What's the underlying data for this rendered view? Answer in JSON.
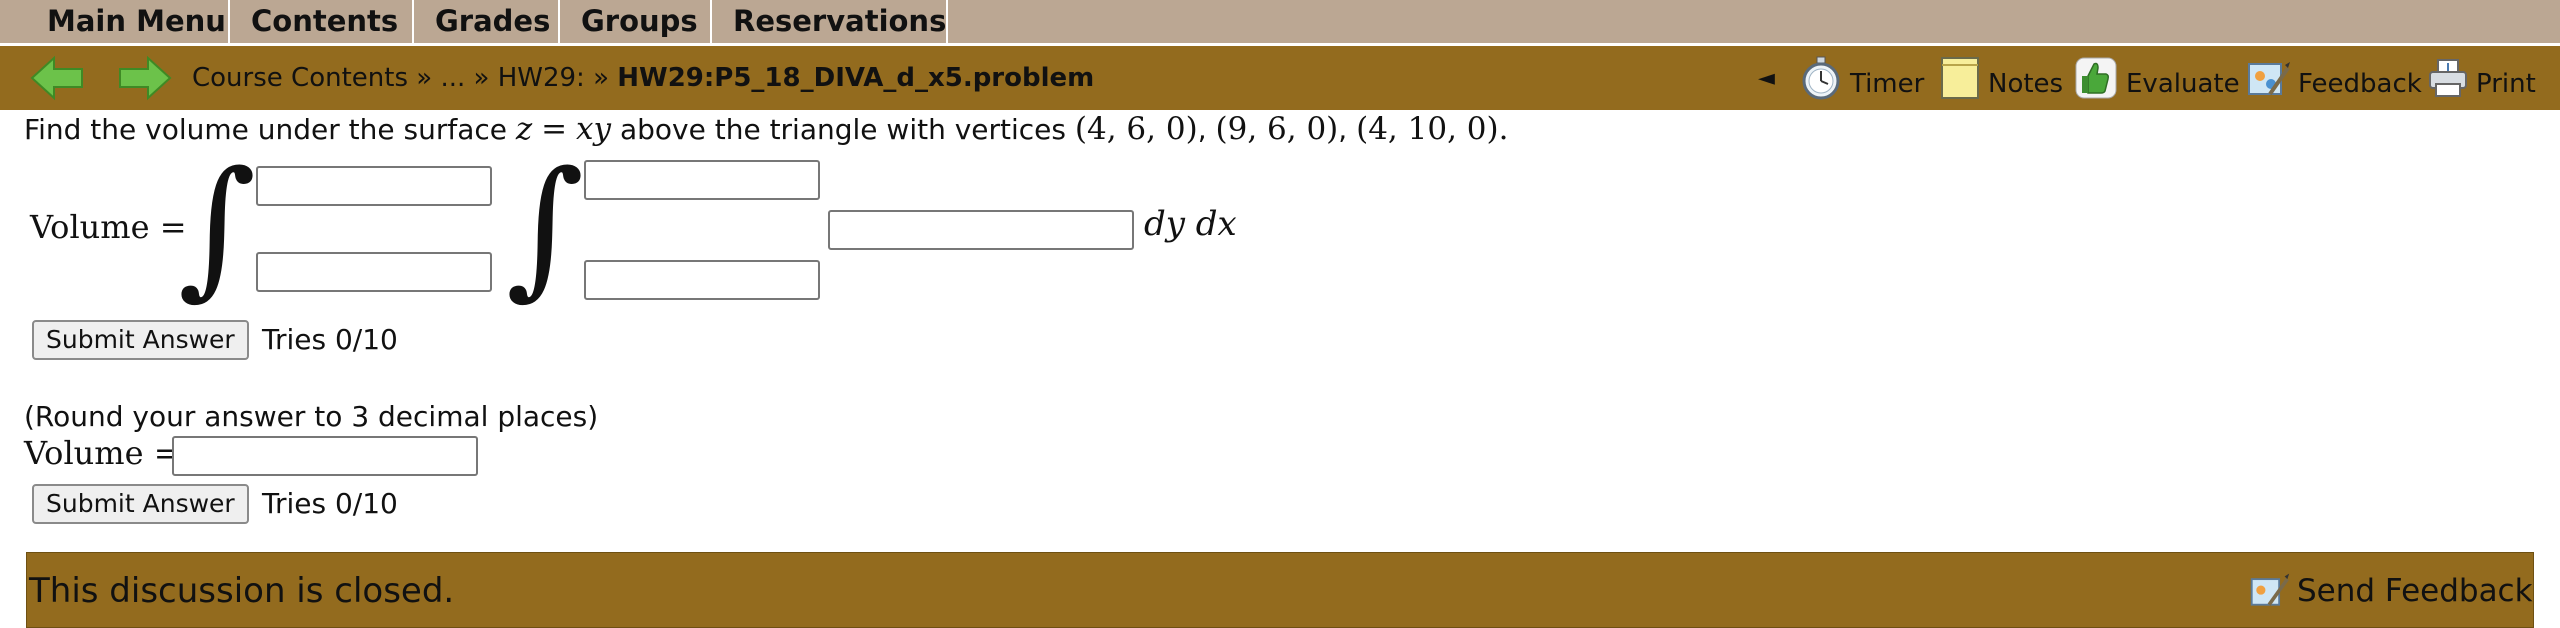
{
  "menu": {
    "items": [
      "Main Menu",
      "Contents",
      "Grades",
      "Groups",
      "Reservations"
    ]
  },
  "nav": {
    "breadcrumb": {
      "course_contents": "Course Contents",
      "sep1": "»",
      "ellipsis": "...",
      "sep2": "»",
      "hw": "HW29:",
      "sep3": "»",
      "current": "HW29:P5_18_DIVA_d_x5.problem"
    },
    "collapse_glyph": "◄",
    "tools": {
      "timer": "Timer",
      "notes": "Notes",
      "evaluate": "Evaluate",
      "feedback": "Feedback",
      "print": "Print"
    }
  },
  "problem": {
    "intro": "Find the volume under the surface",
    "eq_lhs": "z",
    "eq_sign": "=",
    "eq_rhs": "xy",
    "middle": "above the triangle with vertices",
    "v1": "(4, 6, 0)",
    "comma1": ",",
    "v2": "(9, 6, 0)",
    "comma2": ",",
    "v3": "(4, 10, 0)",
    "period": "."
  },
  "part1": {
    "volume_label": "Volume =",
    "integral_symbol": "∫",
    "outer_upper": "",
    "outer_lower": "",
    "inner_upper": "",
    "inner_lower": "",
    "integrand": "",
    "differentials": "dy dx",
    "submit_label": "Submit Answer",
    "tries": "Tries 0/10"
  },
  "part2": {
    "hint": "(Round your answer to 3 decimal places)",
    "volume_label": "Volume =",
    "answer": "",
    "submit_label": "Submit Answer",
    "tries": "Tries 0/10"
  },
  "discussion": {
    "status": "This discussion is closed.",
    "send_feedback": "Send Feedback"
  },
  "colors": {
    "menu_bg": "#bba793",
    "nav_bg": "#936b1e",
    "arrow_green": "#6cc24a"
  }
}
